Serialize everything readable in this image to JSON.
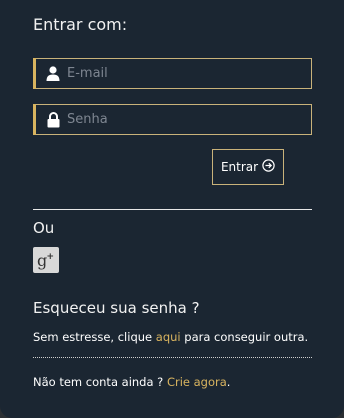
{
  "login": {
    "heading": "Entrar com:",
    "email_placeholder": "E-mail",
    "password_placeholder": "Senha",
    "submit_label": "Entrar",
    "user_icon": "user-icon",
    "lock_icon": "lock-icon",
    "submit_icon": "arrow-right-circle-icon"
  },
  "social": {
    "separator_label": "Ou",
    "google_plus_icon": "google-plus-icon"
  },
  "forgot": {
    "heading": "Esqueceu sua senha ?",
    "text_before": "Sem estresse, clique ",
    "link_label": "aqui",
    "text_after": " para conseguir outra."
  },
  "signup": {
    "text_before": "Não tem conta ainda ? ",
    "link_label": "Crie agora",
    "text_after": "."
  },
  "colors": {
    "background": "#1b2632",
    "accent": "#d9b45f",
    "border": "#c9b27a"
  }
}
